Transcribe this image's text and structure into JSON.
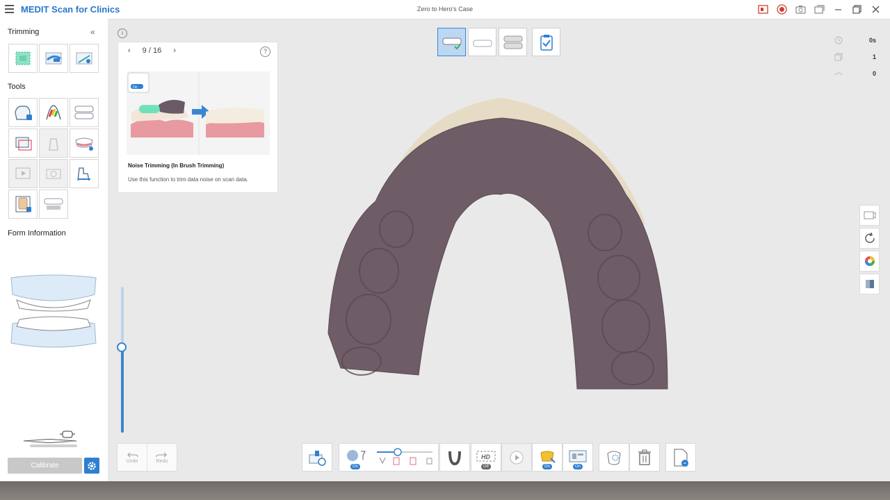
{
  "app": {
    "name": "MEDIT Scan for Clinics",
    "case_title": "Zero to Hero's Case"
  },
  "sidebar": {
    "trimming_title": "Trimming",
    "tools_title": "Tools",
    "form_info_title": "Form Information",
    "calibrate_label": "Calibrate"
  },
  "guide": {
    "page": "9 / 16",
    "title": "Noise Trimming (In Brush Trimming)",
    "description": "Use this function to trim data noise on scan data.",
    "badge_label": "On"
  },
  "stats": {
    "time": "0s",
    "count_a": "1",
    "count_b": "0"
  },
  "bottom": {
    "undo_label": "Undo",
    "redo_label": "Redo",
    "on_label": "On",
    "off_label": "Off",
    "hd_label": "HD"
  },
  "colors": {
    "accent": "#2f7fd0",
    "brand": "#2878c8",
    "model": "#6e5d66",
    "teeth": "#e6dcc5"
  }
}
